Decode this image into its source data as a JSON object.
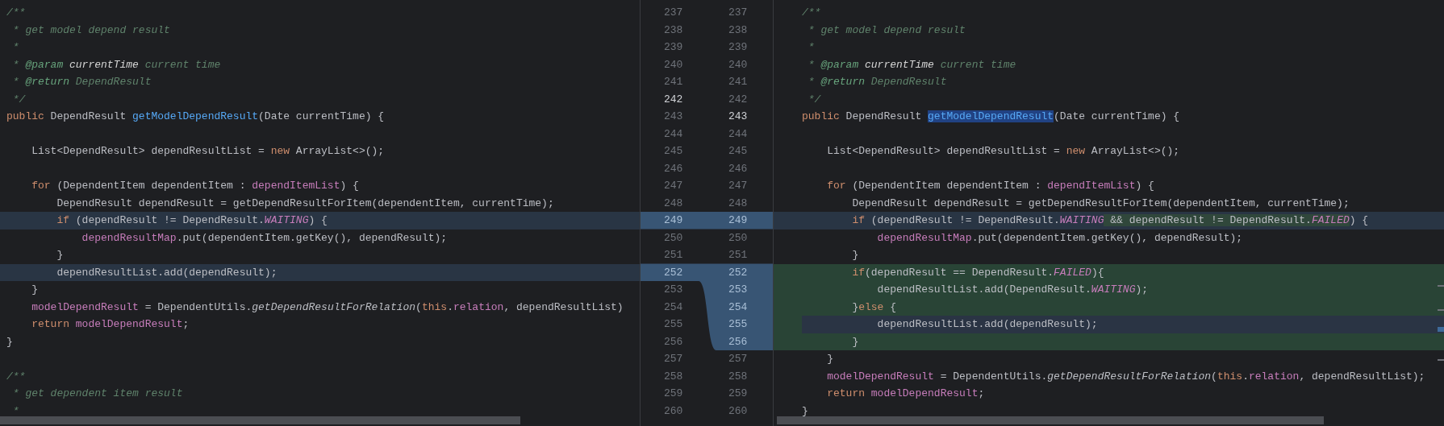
{
  "left": {
    "lines": [
      {
        "number": "237",
        "kind": "unchanged",
        "current": false,
        "tokens": [
          {
            "text": "/**",
            "kind": "comment"
          }
        ]
      },
      {
        "number": "238",
        "kind": "unchanged",
        "current": false,
        "tokens": [
          {
            "text": " * get model depend result",
            "kind": "comment"
          }
        ]
      },
      {
        "number": "239",
        "kind": "unchanged",
        "current": false,
        "tokens": [
          {
            "text": " *",
            "kind": "comment"
          }
        ]
      },
      {
        "number": "240",
        "kind": "unchanged",
        "current": false,
        "tokens": [
          {
            "text": " * ",
            "kind": "comment"
          },
          {
            "text": "@param",
            "kind": "doctag"
          },
          {
            "text": " currentTime",
            "kind": "docparam"
          },
          {
            "text": " current time",
            "kind": "comment"
          }
        ]
      },
      {
        "number": "241",
        "kind": "unchanged",
        "current": false,
        "tokens": [
          {
            "text": " * ",
            "kind": "comment"
          },
          {
            "text": "@return",
            "kind": "doctag"
          },
          {
            "text": " DependResult",
            "kind": "comment"
          }
        ]
      },
      {
        "number": "242",
        "kind": "unchanged",
        "current": true,
        "tokens": [
          {
            "text": " */",
            "kind": "comment"
          }
        ]
      },
      {
        "number": "243",
        "kind": "unchanged",
        "current": false,
        "tokens": [
          {
            "text": "public",
            "kind": "keyword"
          },
          {
            "text": " DependResult ",
            "kind": "plain"
          },
          {
            "text": "getModelDependResult",
            "kind": "method"
          },
          {
            "text": "(Date currentTime) {",
            "kind": "plain"
          }
        ]
      },
      {
        "number": "244",
        "kind": "unchanged",
        "current": false
      },
      {
        "number": "245",
        "kind": "unchanged",
        "current": false,
        "tokens": [
          {
            "text": "    List<DependResult> dependResultList = ",
            "kind": "plain"
          },
          {
            "text": "new",
            "kind": "keyword"
          },
          {
            "text": " ArrayList<>();",
            "kind": "plain"
          }
        ]
      },
      {
        "number": "246",
        "kind": "unchanged",
        "current": false
      },
      {
        "number": "247",
        "kind": "unchanged",
        "current": false,
        "tokens": [
          {
            "text": "    for",
            "kind": "keyword"
          },
          {
            "text": " (DependentItem dependentItem : ",
            "kind": "plain"
          },
          {
            "text": "dependItemList",
            "kind": "field"
          },
          {
            "text": ") {",
            "kind": "plain"
          }
        ]
      },
      {
        "number": "248",
        "kind": "unchanged",
        "current": false,
        "tokens": [
          {
            "text": "        DependResult dependResult = getDependResultForItem(dependentItem, currentTime);",
            "kind": "plain"
          }
        ]
      },
      {
        "number": "249",
        "kind": "modified",
        "current": false,
        "tokens": [
          {
            "text": "        if",
            "kind": "keyword"
          },
          {
            "text": " (dependResult != DependResult.",
            "kind": "plain"
          },
          {
            "text": "WAITING",
            "kind": "constant"
          },
          {
            "text": ") {",
            "kind": "plain"
          }
        ]
      },
      {
        "number": "250",
        "kind": "unchanged",
        "current": false,
        "tokens": [
          {
            "text": "            dependResultMap",
            "kind": "field"
          },
          {
            "text": ".put(dependentItem.getKey(), dependResult);",
            "kind": "plain"
          }
        ]
      },
      {
        "number": "251",
        "kind": "unchanged",
        "current": false,
        "tokens": [
          {
            "text": "        }",
            "kind": "plain"
          }
        ]
      },
      {
        "number": "252",
        "kind": "modified",
        "current": false,
        "tokens": [
          {
            "text": "        dependResultList.add(dependResult);",
            "kind": "plain"
          }
        ]
      },
      {
        "number": "253",
        "kind": "unchanged",
        "current": false,
        "tokens": [
          {
            "text": "    }",
            "kind": "plain"
          }
        ]
      },
      {
        "number": "254",
        "kind": "unchanged",
        "current": false,
        "tokens": [
          {
            "text": "    modelDependResult",
            "kind": "field"
          },
          {
            "text": " = DependentUtils.",
            "kind": "plain"
          },
          {
            "text": "getDependResultForRelation",
            "kind": "static"
          },
          {
            "text": "(",
            "kind": "plain"
          },
          {
            "text": "this",
            "kind": "keyword"
          },
          {
            "text": ".",
            "kind": "plain"
          },
          {
            "text": "relation",
            "kind": "field"
          },
          {
            "text": ", dependResultList)",
            "kind": "plain"
          }
        ]
      },
      {
        "number": "255",
        "kind": "unchanged",
        "current": false,
        "tokens": [
          {
            "text": "    return",
            "kind": "keyword"
          },
          {
            "text": " modelDependResult",
            "kind": "field"
          },
          {
            "text": ";",
            "kind": "plain"
          }
        ]
      },
      {
        "number": "256",
        "kind": "unchanged",
        "current": false,
        "tokens": [
          {
            "text": "}",
            "kind": "plain"
          }
        ]
      },
      {
        "number": "257",
        "kind": "unchanged",
        "current": false
      },
      {
        "number": "258",
        "kind": "unchanged",
        "current": false,
        "tokens": [
          {
            "text": "/**",
            "kind": "comment"
          }
        ]
      },
      {
        "number": "259",
        "kind": "unchanged",
        "current": false,
        "tokens": [
          {
            "text": " * get dependent item result",
            "kind": "comment"
          }
        ]
      },
      {
        "number": "260",
        "kind": "unchanged",
        "current": false,
        "tokens": [
          {
            "text": " *",
            "kind": "comment"
          }
        ]
      }
    ]
  },
  "right": {
    "lines": [
      {
        "number": "237",
        "kind": "unchanged",
        "current": false,
        "caret": false,
        "tokens": [
          {
            "text": "/**",
            "kind": "comment"
          }
        ]
      },
      {
        "number": "238",
        "kind": "unchanged",
        "current": false,
        "caret": false,
        "tokens": [
          {
            "text": " * get model depend result",
            "kind": "comment"
          }
        ]
      },
      {
        "number": "239",
        "kind": "unchanged",
        "current": false,
        "caret": false,
        "tokens": [
          {
            "text": " *",
            "kind": "comment"
          }
        ]
      },
      {
        "number": "240",
        "kind": "unchanged",
        "current": false,
        "caret": false,
        "tokens": [
          {
            "text": " * ",
            "kind": "comment"
          },
          {
            "text": "@param",
            "kind": "doctag"
          },
          {
            "text": " currentTime",
            "kind": "docparam"
          },
          {
            "text": " current time",
            "kind": "comment"
          }
        ]
      },
      {
        "number": "241",
        "kind": "unchanged",
        "current": false,
        "caret": false,
        "tokens": [
          {
            "text": " * ",
            "kind": "comment"
          },
          {
            "text": "@return",
            "kind": "doctag"
          },
          {
            "text": " DependResult",
            "kind": "comment"
          }
        ]
      },
      {
        "number": "242",
        "kind": "unchanged",
        "current": false,
        "caret": false,
        "tokens": [
          {
            "text": " */",
            "kind": "comment"
          }
        ]
      },
      {
        "number": "243",
        "kind": "unchanged",
        "current": true,
        "caret": false,
        "tokens": [
          {
            "text": "public",
            "kind": "keyword"
          },
          {
            "text": " DependResult ",
            "kind": "plain"
          },
          {
            "text": "getModelDependResult",
            "kind": "method_selected"
          },
          {
            "text": "(Date currentTime) {",
            "kind": "plain"
          }
        ]
      },
      {
        "number": "244",
        "kind": "unchanged",
        "current": false,
        "caret": false
      },
      {
        "number": "245",
        "kind": "unchanged",
        "current": false,
        "caret": false,
        "tokens": [
          {
            "text": "    List<DependResult> dependResultList = ",
            "kind": "plain"
          },
          {
            "text": "new",
            "kind": "keyword"
          },
          {
            "text": " ArrayList<>();",
            "kind": "plain"
          }
        ]
      },
      {
        "number": "246",
        "kind": "unchanged",
        "current": false,
        "caret": false
      },
      {
        "number": "247",
        "kind": "unchanged",
        "current": false,
        "caret": false,
        "tokens": [
          {
            "text": "    for",
            "kind": "keyword"
          },
          {
            "text": " (DependentItem dependentItem : ",
            "kind": "plain"
          },
          {
            "text": "dependItemList",
            "kind": "field"
          },
          {
            "text": ") {",
            "kind": "plain"
          }
        ]
      },
      {
        "number": "248",
        "kind": "unchanged",
        "current": false,
        "caret": false,
        "tokens": [
          {
            "text": "        DependResult dependResult = getDependResultForItem(dependentItem, currentTime);",
            "kind": "plain"
          }
        ]
      },
      {
        "number": "249",
        "kind": "modified",
        "current": false,
        "caret": false,
        "tokens": [
          {
            "text": "        if",
            "kind": "keyword"
          },
          {
            "text": " (dependResult != DependResult.",
            "kind": "plain"
          },
          {
            "text": "WAITING",
            "kind": "constant"
          },
          {
            "text": " && dependResult != DependResult.",
            "kind": "plain_added"
          },
          {
            "text": "FAILED",
            "kind": "constant_added"
          },
          {
            "text": ") {",
            "kind": "plain"
          }
        ]
      },
      {
        "number": "250",
        "kind": "unchanged",
        "current": false,
        "caret": false,
        "tokens": [
          {
            "text": "            dependResultMap",
            "kind": "field"
          },
          {
            "text": ".put(dependentItem.getKey(), dependResult);",
            "kind": "plain"
          }
        ]
      },
      {
        "number": "251",
        "kind": "unchanged",
        "current": false,
        "caret": false,
        "tokens": [
          {
            "text": "        }",
            "kind": "plain"
          }
        ]
      },
      {
        "number": "252",
        "kind": "inserted",
        "current": false,
        "caret": false,
        "tokens": [
          {
            "text": "        if",
            "kind": "keyword"
          },
          {
            "text": "(dependResult == DependResult.",
            "kind": "plain"
          },
          {
            "text": "FAILED",
            "kind": "constant"
          },
          {
            "text": "){",
            "kind": "plain"
          }
        ]
      },
      {
        "number": "253",
        "kind": "inserted",
        "current": false,
        "caret": false,
        "tokens": [
          {
            "text": "            dependResultList.add(DependResult.",
            "kind": "plain"
          },
          {
            "text": "WAITING",
            "kind": "constant"
          },
          {
            "text": ");",
            "kind": "plain"
          }
        ]
      },
      {
        "number": "254",
        "kind": "inserted",
        "current": false,
        "caret": false,
        "tokens": [
          {
            "text": "        }",
            "kind": "plain"
          },
          {
            "text": "else",
            "kind": "keyword"
          },
          {
            "text": " {",
            "kind": "plain"
          }
        ]
      },
      {
        "number": "255",
        "kind": "inserted",
        "current": false,
        "caret": true,
        "tokens": [
          {
            "text": "            dependResultList.add(dependResult);",
            "kind": "plain"
          }
        ]
      },
      {
        "number": "256",
        "kind": "inserted",
        "current": false,
        "caret": false,
        "tokens": [
          {
            "text": "        }",
            "kind": "plain"
          }
        ]
      },
      {
        "number": "257",
        "kind": "unchanged",
        "current": false,
        "caret": false,
        "tokens": [
          {
            "text": "    }",
            "kind": "plain"
          }
        ]
      },
      {
        "number": "258",
        "kind": "unchanged",
        "current": false,
        "caret": false,
        "tokens": [
          {
            "text": "    modelDependResult",
            "kind": "field"
          },
          {
            "text": " = DependentUtils.",
            "kind": "plain"
          },
          {
            "text": "getDependResultForRelation",
            "kind": "static"
          },
          {
            "text": "(",
            "kind": "plain"
          },
          {
            "text": "this",
            "kind": "keyword"
          },
          {
            "text": ".",
            "kind": "plain"
          },
          {
            "text": "relation",
            "kind": "field"
          },
          {
            "text": ", dependResultList);",
            "kind": "plain"
          }
        ]
      },
      {
        "number": "259",
        "kind": "unchanged",
        "current": false,
        "caret": false,
        "tokens": [
          {
            "text": "    return",
            "kind": "keyword"
          },
          {
            "text": " modelDependResult",
            "kind": "field"
          },
          {
            "text": ";",
            "kind": "plain"
          }
        ]
      },
      {
        "number": "260",
        "kind": "unchanged",
        "current": false,
        "caret": false,
        "tokens": [
          {
            "text": "}",
            "kind": "plain"
          }
        ]
      }
    ]
  }
}
